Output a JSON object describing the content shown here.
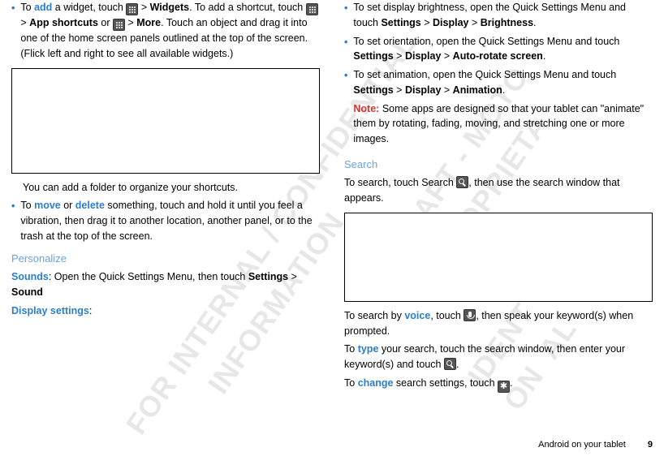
{
  "col1": {
    "item1": {
      "pre": "To ",
      "action": "add",
      "seg1": " a widget, touch ",
      "seg2": " > ",
      "widgets": "Widgets",
      "seg3": ". To add a shortcut, touch ",
      "seg4": " > ",
      "appshortcuts": "App shortcuts",
      "or": " or  ",
      "seg5": " > ",
      "more": "More",
      "seg6": ". Touch an object and drag it into one of the home screen panels outlined at the top of the screen. (Flick left and right to see all available widgets.)"
    },
    "folder_text": "You can add a folder to organize your shortcuts.",
    "item2": {
      "pre": "To ",
      "move": "move",
      "or": " or ",
      "delete": "delete",
      "rest": " something, touch and hold it until you feel a vibration, then drag it to another location, another panel, or to the trash at the top of the screen."
    },
    "personalize_title": "Personalize",
    "sounds": {
      "label": "Sounds",
      "text": ": Open the Quick Settings Menu, then touch ",
      "settings": "Settings",
      "gt": " > ",
      "sound": "Sound"
    },
    "display_settings": "Display settings",
    "colon": ":"
  },
  "col2": {
    "b1": {
      "text1": "To set display brightness, open the Quick Settings Menu and touch ",
      "settings": "Settings",
      "gt": " > ",
      "display": "Display",
      "gt2": " > ",
      "brightness": "Brightness",
      "period": "."
    },
    "b2": {
      "text1": "To set orientation, open the Quick Settings Menu and touch ",
      "settings": "Settings",
      "gt": " > ",
      "display": "Display",
      "gt2": " > ",
      "autorotate": "Auto-rotate screen",
      "period": "."
    },
    "b3": {
      "text1": "To set animation, open the Quick Settings Menu and touch ",
      "settings": "Settings",
      "gt": " > ",
      "display": "Display",
      "gt2": " > ",
      "animation": "Animation",
      "period": "."
    },
    "note_label": "Note:",
    "note_text": " Some apps are designed so that your tablet can \"animate\" them by rotating, fading, moving, and stretching one or more images.",
    "search_title": "Search",
    "search_intro1": "To search, touch Search ",
    "search_intro2": ", then use the search window that appears.",
    "voice_pre": "To search by ",
    "voice": "voice",
    "voice_mid": ", touch ",
    "voice_post": ", then speak your keyword(s) when prompted.",
    "type_pre": "To ",
    "type": "type",
    "type_mid": " your search, touch the search window, then enter your keyword(s) and touch ",
    "type_post": ".",
    "change_pre": "To ",
    "change": "change",
    "change_mid": " search settings, touch ",
    "change_post": "."
  },
  "footer": {
    "text": "Android on your tablet",
    "page": "9"
  },
  "watermarks": {
    "wm1": "FOR INTERNAL / CONFIDENTIAL\n         INFORMATION",
    "wm2": "DRAFT - MOTO\n  PROPRIETA",
    "wm3": "IDENT\nON  AL"
  }
}
